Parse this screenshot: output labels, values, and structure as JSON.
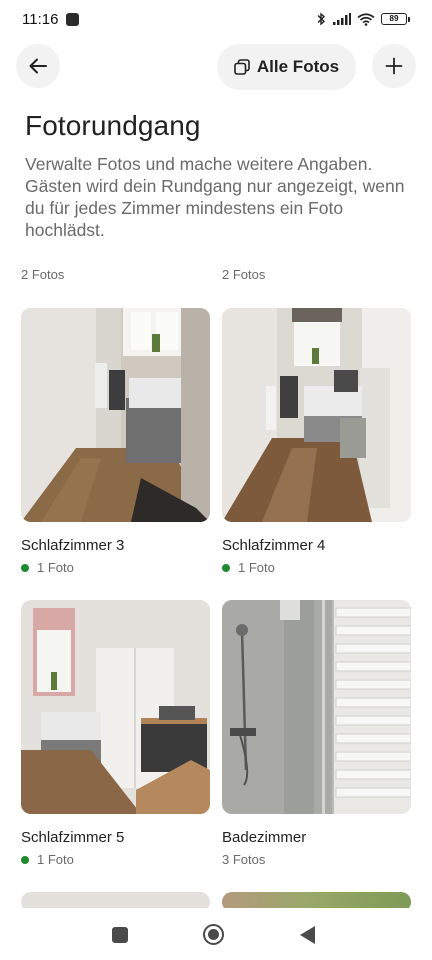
{
  "status_bar": {
    "time": "11:16",
    "battery": "89"
  },
  "header": {
    "back_icon": "arrow-left-icon",
    "all_photos_label": "Alle Fotos",
    "all_photos_icon": "photos-stack-icon",
    "add_icon": "plus-icon"
  },
  "page": {
    "title": "Fotorundgang",
    "description": "Verwalte Fotos und mache weitere Angaben. Gästen wird dein Rundgang nur angezeigt, wenn du für jedes Zimmer mindestens ein Foto hochlädst."
  },
  "counts": [
    "2 Fotos",
    "2 Fotos"
  ],
  "rooms": [
    {
      "name": "Schlafzimmer 3",
      "photos": "1 Foto",
      "status_color": "#1e8a2e"
    },
    {
      "name": "Schlafzimmer 4",
      "photos": "1 Foto",
      "status_color": "#1e8a2e"
    },
    {
      "name": "Schlafzimmer 5",
      "photos": "1 Foto",
      "status_color": "#1e8a2e"
    },
    {
      "name": "Badezimmer",
      "photos": "3 Fotos"
    }
  ],
  "system_nav": {
    "recents_icon": "square-icon",
    "home_icon": "circle-icon",
    "back_icon": "triangle-back-icon"
  }
}
